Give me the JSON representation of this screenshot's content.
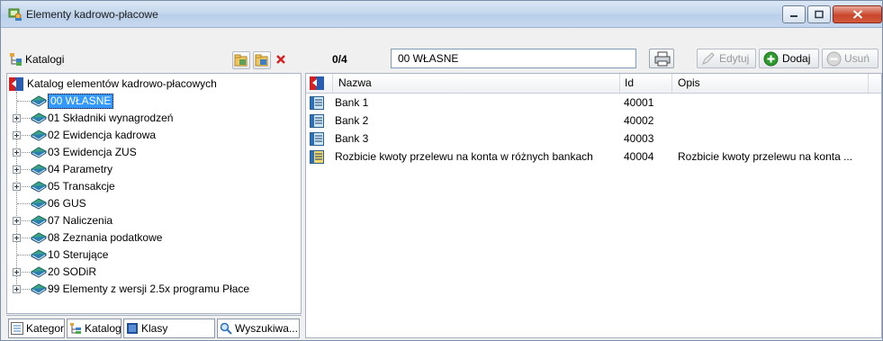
{
  "window": {
    "title": "Elementy kadrowo-płacowe"
  },
  "left_panel": {
    "label": "Katalogi",
    "tree_root": "Katalog elementów kadrowo-płacowych",
    "tree_items": [
      {
        "label": "00 WŁASNE",
        "selected": true,
        "expandable": false
      },
      {
        "label": "01 Składniki wynagrodzeń",
        "expandable": true
      },
      {
        "label": "02 Ewidencja kadrowa",
        "expandable": true
      },
      {
        "label": "03 Ewidencja ZUS",
        "expandable": true
      },
      {
        "label": "04 Parametry",
        "expandable": true
      },
      {
        "label": "05 Transakcje",
        "expandable": true
      },
      {
        "label": "06 GUS",
        "expandable": false
      },
      {
        "label": "07 Naliczenia",
        "expandable": true
      },
      {
        "label": "08 Zeznania podatkowe",
        "expandable": true
      },
      {
        "label": "10 Sterujące",
        "expandable": false
      },
      {
        "label": "20 SODiR",
        "expandable": true
      },
      {
        "label": "99 Elementy z wersji 2.5x programu Płace",
        "expandable": true
      }
    ],
    "tabs": [
      "Kategorie",
      "Katalogi",
      "Klasy",
      "Wyszukiwa..."
    ]
  },
  "toolbar": {
    "counter": "0/4",
    "catalog_value": "00 WŁASNE",
    "edit_label": "Edytuj",
    "add_label": "Dodaj",
    "delete_label": "Usuń"
  },
  "grid": {
    "columns": [
      "Nazwa",
      "Id",
      "Opis"
    ],
    "rows": [
      {
        "name": "Bank 1",
        "id": "40001",
        "desc": ""
      },
      {
        "name": "Bank 2",
        "id": "40002",
        "desc": ""
      },
      {
        "name": "Bank 3",
        "id": "40003",
        "desc": ""
      },
      {
        "name": "Rozbicie kwoty przelewu na konta w różnych bankach",
        "id": "40004",
        "desc": "Rozbicie kwoty przelewu na konta ..."
      }
    ]
  },
  "colors": {
    "selection": "#3399ff",
    "add_green": "#2e9a2e",
    "close_red": "#c9462c"
  }
}
